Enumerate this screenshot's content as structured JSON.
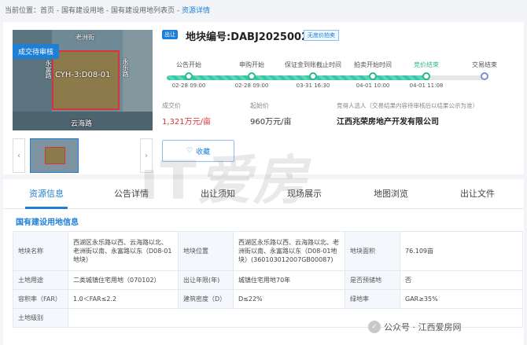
{
  "breadcrumb": {
    "prefix": "当前位置：",
    "home": "首页",
    "sep": " - ",
    "level1": "国有建设用地",
    "level2": "国有建设用地列表页",
    "current": "资源详情"
  },
  "photo": {
    "badge": "成交待审核",
    "road_north": "老洲街",
    "road_south": "云海路",
    "road_west": "永富路",
    "road_east": "永乐路",
    "plot_label": "CYH-3:D08-01"
  },
  "listing": {
    "tag": "出让",
    "plot_number": "地块编号:DABJ2025002",
    "auction_tag": "无底价拍卖"
  },
  "timeline": {
    "steps": [
      {
        "name": "公告开始",
        "date": "02-28 09:00",
        "active": false
      },
      {
        "name": "申购开始",
        "date": "02-28 09:00",
        "active": false
      },
      {
        "name": "保证金到账截止时间",
        "date": "03-31 16:30",
        "active": false
      },
      {
        "name": "拍卖开始时间",
        "date": "04-01 10:00",
        "active": false
      },
      {
        "name": "竞价结束",
        "date": "04-01 11:08",
        "active": true
      },
      {
        "name": "交易结束",
        "date": "",
        "active": false
      }
    ]
  },
  "price": {
    "deal_label": "成交价",
    "deal_value": "1,321万元/亩",
    "start_label": "起始价",
    "start_value": "960万元/亩",
    "winner_label": "竞得人选人（交易结果内容待审核后以结果公示为准）",
    "winner_value": "江西兆荣房地产开发有限公司"
  },
  "favorite": {
    "label": "收藏",
    "icon": "heart-icon"
  },
  "tabs": [
    "资源信息",
    "公告详情",
    "出让须知",
    "现场展示",
    "地图浏览",
    "出让文件"
  ],
  "section_title": "国有建设用地信息",
  "table": {
    "row1": {
      "k1": "地块名称",
      "v1": "西湖区永乐路以西、云海路以北、老洲街以南、永富路以东（D08-01地块）",
      "k2": "地块位置",
      "v2": "西湖区永乐路以西、云海路以北、老洲街以南、永富路以东（D08-01地块）(360103012007GB00087)",
      "k3": "地块面积",
      "v3": "76.109亩"
    },
    "row2": {
      "k1": "土地用途",
      "v1": "二类城镇住宅用地（070102）",
      "k2": "出让年限(年)",
      "v2": "城镇住宅用地70年",
      "k3": "是否预储地",
      "v3": "否"
    },
    "row3": {
      "k1": "容积率（FAR）",
      "v1": "1.0＜FAR≤2.2",
      "k2": "建筑密度（D）",
      "v2": "D≤22%",
      "k3": "绿地率",
      "v3": "GAR≥35%"
    },
    "row4": {
      "k1": "土地级别",
      "v1": ""
    }
  },
  "watermark": "爱房",
  "wechat": {
    "icon": "wechat-icon",
    "text": "公众号 · 江西爱房网"
  },
  "colors": {
    "accent": "#1e7fd6",
    "deal": "#d8343a",
    "progress": "#36c6a8"
  }
}
